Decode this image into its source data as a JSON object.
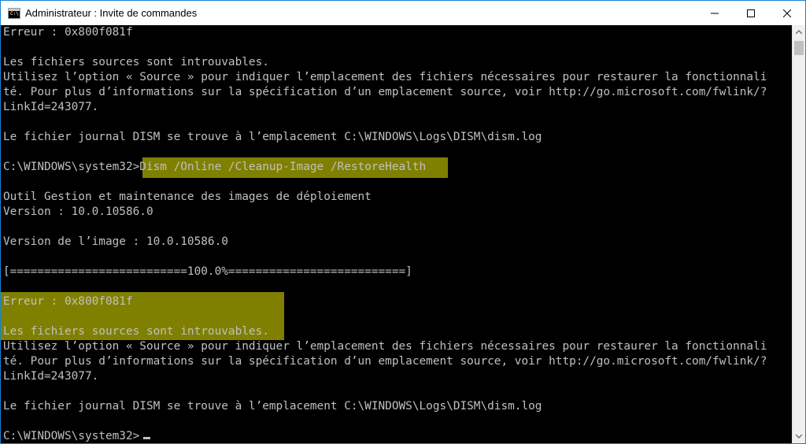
{
  "window": {
    "title": "Administrateur : Invite de commandes",
    "icon": "cmd-icon",
    "icon_text": "C:\\.",
    "controls": [
      "minimize-icon",
      "maximize-icon",
      "close-icon"
    ]
  },
  "console": {
    "lines": [
      "Erreur : 0x800f081f",
      "",
      "Les fichiers sources sont introuvables.",
      "Utilisez l’option « Source » pour indiquer l’emplacement des fichiers nécessaires pour restaurer la fonctionnali",
      "té. Pour plus d’informations sur la spécification d’un emplacement source, voir http://go.microsoft.com/fwlink/?",
      "LinkId=243077.",
      "",
      "Le fichier journal DISM se trouve à l’emplacement C:\\WINDOWS\\Logs\\DISM\\dism.log",
      "",
      "",
      "",
      "Outil Gestion et maintenance des images de déploiement",
      "Version : 10.0.10586.0",
      "",
      "Version de l’image : 10.0.10586.0",
      "",
      "[==========================100.0%==========================]",
      "",
      "Erreur : 0x800f081f",
      "",
      "Les fichiers sources sont introuvables.",
      "Utilisez l’option « Source » pour indiquer l’emplacement des fichiers nécessaires pour restaurer la fonctionnali",
      "té. Pour plus d’informations sur la spécification d’un emplacement source, voir http://go.microsoft.com/fwlink/?",
      "LinkId=243077.",
      "",
      "Le fichier journal DISM se trouve à l’emplacement C:\\WINDOWS\\Logs\\DISM\\dism.log",
      "",
      ""
    ],
    "command_prompt": "C:\\WINDOWS\\system32>",
    "command": "Dism /Online /Cleanup-Image /RestoreHealth",
    "final_prompt": "C:\\WINDOWS\\system32>",
    "highlight_color": "#808000",
    "text_color": "#c0c0c0",
    "background": "#000000"
  }
}
